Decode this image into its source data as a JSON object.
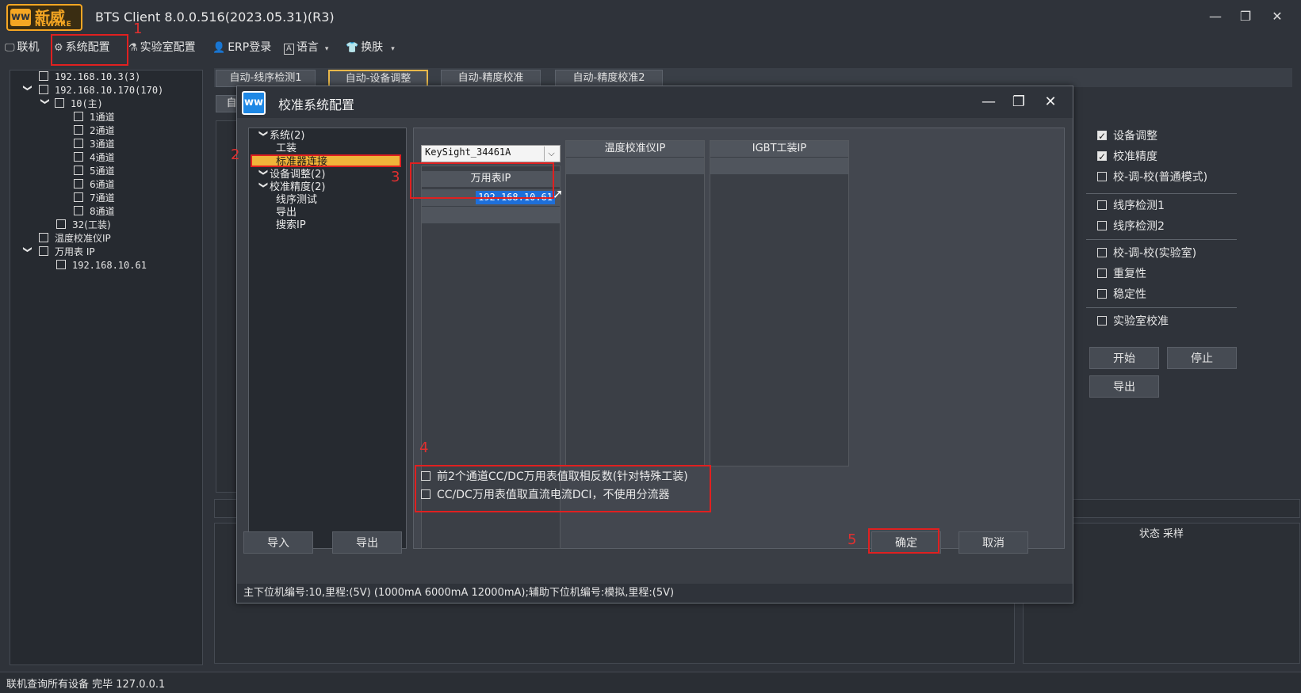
{
  "app": {
    "logo_cn": "新威",
    "logo_en": "NEWARE",
    "title": "BTS Client 8.0.0.516(2023.05.31)(R3)"
  },
  "window_controls": {
    "minimize": "—",
    "restore": "❐",
    "close": "✕"
  },
  "menu": {
    "connect": "联机",
    "system_config": "系统配置",
    "lab_config": "实验室配置",
    "erp_login": "ERP登录",
    "language": "语言",
    "skin": "换肤"
  },
  "annotations": [
    "1",
    "2",
    "3",
    "4",
    "5"
  ],
  "left_tree": [
    {
      "label": "192.168.10.3(3)",
      "checked": false
    },
    {
      "label": "192.168.10.170(170)",
      "checked": false
    },
    {
      "label": "10(主)",
      "checked": false
    },
    {
      "label": "1通道",
      "checked": false
    },
    {
      "label": "2通道",
      "checked": false
    },
    {
      "label": "3通道",
      "checked": false
    },
    {
      "label": "4通道",
      "checked": false
    },
    {
      "label": "5通道",
      "checked": false
    },
    {
      "label": "6通道",
      "checked": false
    },
    {
      "label": "7通道",
      "checked": false
    },
    {
      "label": "8通道",
      "checked": false
    },
    {
      "label": "32(工装)",
      "checked": false
    },
    {
      "label": "温度校准仪IP",
      "checked": false
    },
    {
      "label": "万用表 IP",
      "checked": false
    },
    {
      "label": "192.168.10.61",
      "checked": false
    }
  ],
  "tabs": [
    {
      "label": "自动-线序检测1",
      "active": false
    },
    {
      "label": "自动-设备调整",
      "active": true
    },
    {
      "label": "自动-精度校准",
      "active": false
    },
    {
      "label": "自动-精度校准2",
      "active": false
    }
  ],
  "tab_second_row": "自",
  "right_panel": {
    "checks": [
      {
        "label": "设备调整",
        "checked": true
      },
      {
        "label": "校准精度",
        "checked": true
      },
      {
        "label": "校-调-校(普通模式)",
        "checked": false
      },
      {
        "label": "线序检测1",
        "checked": false
      },
      {
        "label": "线序检测2",
        "checked": false
      },
      {
        "label": "校-调-校(实验室)",
        "checked": false
      },
      {
        "label": "重复性",
        "checked": false
      },
      {
        "label": "稳定性",
        "checked": false
      },
      {
        "label": "实验室校准",
        "checked": false
      }
    ],
    "start_btn": "开始",
    "stop_btn": "停止",
    "export_btn": "导出"
  },
  "bottom_right_header": "状态 采样",
  "dialog": {
    "title": "校准系统配置",
    "tree": [
      {
        "label": "系统(2)",
        "expanded": true
      },
      {
        "label": "工装"
      },
      {
        "label": "标准器连接",
        "selected": true
      },
      {
        "label": "设备调整(2)",
        "expanded": true
      },
      {
        "label": "校准精度(2)",
        "expanded": true
      },
      {
        "label": "线序测试"
      },
      {
        "label": "导出"
      },
      {
        "label": "搜索IP"
      }
    ],
    "device_select": "KeySight_34461A",
    "columns": {
      "multimeter_header": "万用表IP",
      "multimeter_ip": "192.168.10.61",
      "temp_header": "温度校准仪IP",
      "igbt_header": "IGBT工装IP"
    },
    "options": [
      {
        "label": "前2个通道CC/DC万用表值取相反数(针对特殊工装)",
        "checked": false
      },
      {
        "label": "CC/DC万用表值取直流电流DCI，不使用分流器",
        "checked": false
      }
    ],
    "import_btn": "导入",
    "export_btn": "导出",
    "ok_btn": "确定",
    "cancel_btn": "取消",
    "status": "主下位机编号:10,里程:(5V) (1000mA 6000mA 12000mA);辅助下位机编号:模拟,里程:(5V)"
  },
  "statusbar": "联机查询所有设备 完毕 127.0.0.1"
}
